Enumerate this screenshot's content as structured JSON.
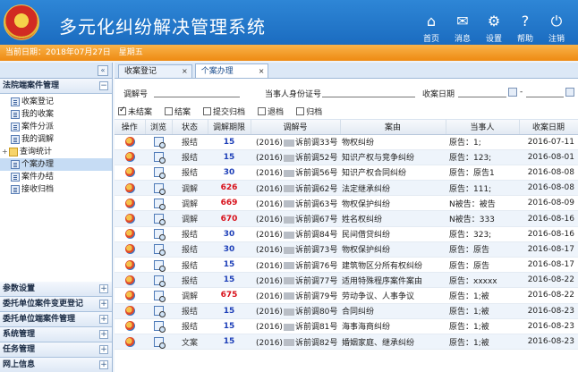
{
  "header": {
    "title": "多元化纠纷解决管理系统",
    "nav": [
      {
        "label": "首页",
        "icon": "home-icon",
        "glyph": "⌂"
      },
      {
        "label": "消息",
        "icon": "mail-icon",
        "glyph": "✉"
      },
      {
        "label": "设置",
        "icon": "gear-icon",
        "glyph": "⚙"
      },
      {
        "label": "帮助",
        "icon": "help-icon",
        "glyph": "?"
      },
      {
        "label": "注销",
        "icon": "power-icon",
        "glyph": "⏻"
      }
    ]
  },
  "datebar": {
    "prefix": "当前日期：2018年07月27日",
    "weekday": "星期五"
  },
  "sidebar": {
    "collapse_glyph": "«",
    "panel_title": "法院端案件管理",
    "panel_toggle": "−",
    "tree": [
      {
        "label": "收案登记",
        "type": "doc"
      },
      {
        "label": "我的收案",
        "type": "doc"
      },
      {
        "label": "案件分派",
        "type": "doc"
      },
      {
        "label": "我的调解",
        "type": "doc"
      },
      {
        "label": "查询统计",
        "type": "folder",
        "toggle": "+"
      },
      {
        "label": "个案办理",
        "type": "doc"
      },
      {
        "label": "案件办结",
        "type": "doc"
      },
      {
        "label": "接收归档",
        "type": "doc"
      }
    ],
    "sections": [
      {
        "label": "参数设置",
        "toggle": "+"
      },
      {
        "label": "委托单位案件变更登记",
        "toggle": "+"
      },
      {
        "label": "委托单位端案件管理",
        "toggle": "+"
      },
      {
        "label": "系统管理",
        "toggle": "+"
      },
      {
        "label": "任务管理",
        "toggle": "+"
      },
      {
        "label": "网上信息",
        "toggle": "+"
      }
    ]
  },
  "tabs": [
    {
      "label": "收案登记",
      "close": "×"
    },
    {
      "label": "个案办理",
      "close": "×"
    }
  ],
  "filter": {
    "mediation_no_label": "调解号",
    "party_id_label": "当事人身份证号",
    "received_date_label": "收案日期",
    "date_sep": "-",
    "checks": [
      {
        "label": "未结案",
        "checked": true
      },
      {
        "label": "结案",
        "checked": false
      },
      {
        "label": "提交归档",
        "checked": false
      },
      {
        "label": "退档",
        "checked": false
      },
      {
        "label": "归档",
        "checked": false
      }
    ]
  },
  "grid": {
    "headers": [
      "操作",
      "浏览",
      "状态",
      "调解期限",
      "调解号",
      "案由",
      "当事人",
      "收案日期"
    ],
    "rows": [
      {
        "status": "报结",
        "term": "15",
        "term_color": "blue",
        "case_a": "(2016)",
        "case_b": "诉前调33号",
        "cause": "物权纠纷",
        "party": "原告：1;",
        "date": "2016-07-11"
      },
      {
        "status": "报结",
        "term": "15",
        "term_color": "blue",
        "case_a": "(2016)",
        "case_b": "诉前调52号",
        "cause": "知识产权与竞争纠纷",
        "party": "原告：123;",
        "date": "2016-08-01"
      },
      {
        "status": "报结",
        "term": "30",
        "term_color": "blue",
        "case_a": "(2016)",
        "case_b": "诉前调56号",
        "cause": "知识产权合同纠纷",
        "party": "原告：原告1",
        "date": "2016-08-08"
      },
      {
        "status": "调解",
        "term": "626",
        "term_color": "red",
        "case_a": "(2016)",
        "case_b": "诉前调62号",
        "cause": "法定继承纠纷",
        "party": "原告：111;",
        "date": "2016-08-08"
      },
      {
        "status": "调解",
        "term": "669",
        "term_color": "red",
        "case_a": "(2016)",
        "case_b": "诉前调63号",
        "cause": "物权保护纠纷",
        "party": "N被告：被告",
        "date": "2016-08-09"
      },
      {
        "status": "调解",
        "term": "670",
        "term_color": "red",
        "case_a": "(2016)",
        "case_b": "诉前调67号",
        "cause": "姓名权纠纷",
        "party": "N被告：333",
        "date": "2016-08-16"
      },
      {
        "status": "报结",
        "term": "30",
        "term_color": "blue",
        "case_a": "(2016)",
        "case_b": "诉前调84号",
        "cause": "民间借贷纠纷",
        "party": "原告：323;",
        "date": "2016-08-16"
      },
      {
        "status": "报结",
        "term": "30",
        "term_color": "blue",
        "case_a": "(2016)",
        "case_b": "诉前调73号",
        "cause": "物权保护纠纷",
        "party": "原告：原告",
        "date": "2016-08-17"
      },
      {
        "status": "报结",
        "term": "15",
        "term_color": "blue",
        "case_a": "(2016)",
        "case_b": "诉前调76号",
        "cause": "建筑物区分所有权纠纷",
        "party": "原告：原告",
        "date": "2016-08-17"
      },
      {
        "status": "报结",
        "term": "15",
        "term_color": "blue",
        "case_a": "(2016)",
        "case_b": "诉前调77号",
        "cause": "适用特殊程序案件案由",
        "party": "原告：xxxxx",
        "date": "2016-08-22"
      },
      {
        "status": "调解",
        "term": "675",
        "term_color": "red",
        "case_a": "(2016)",
        "case_b": "诉前调79号",
        "cause": "劳动争议、人事争议",
        "party": "原告：1;被",
        "date": "2016-08-22"
      },
      {
        "status": "报结",
        "term": "15",
        "term_color": "blue",
        "case_a": "(2016)",
        "case_b": "诉前调80号",
        "cause": "合同纠纷",
        "party": "原告：1;被",
        "date": "2016-08-23"
      },
      {
        "status": "报结",
        "term": "15",
        "term_color": "blue",
        "case_a": "(2016)",
        "case_b": "诉前调81号",
        "cause": "海事海商纠纷",
        "party": "原告：1;被",
        "date": "2016-08-23"
      },
      {
        "status": "文案",
        "term": "15",
        "term_color": "blue",
        "case_a": "(2016)",
        "case_b": "诉前调82号",
        "cause": "婚姻家庭、继承纠纷",
        "party": "原告：1;被",
        "date": "2016-08-23"
      }
    ]
  }
}
